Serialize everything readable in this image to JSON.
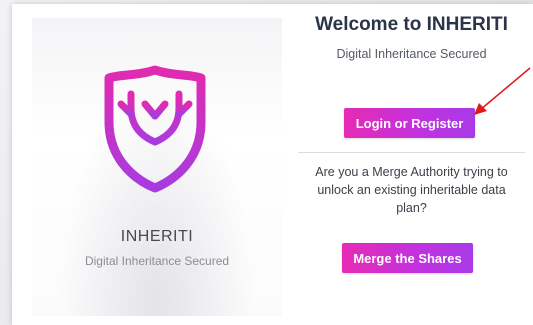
{
  "welcome": {
    "title": "Welcome to INHERITI",
    "subtitle": "Digital Inheritance Secured",
    "login_button": "Login or Register",
    "merge_question": "Are you a Merge Authority trying to unlock an existing inheritable data plan?",
    "merge_button": "Merge the Shares"
  },
  "brand": {
    "name": "INHERITI",
    "tagline": "Digital Inheritance Secured",
    "logo_icon": "shield-tree-icon"
  },
  "colors": {
    "accent_start": "#e62bb4",
    "accent_end": "#a83ae6",
    "title_color": "#2b3548",
    "annotation_arrow": "#e01a1a"
  }
}
